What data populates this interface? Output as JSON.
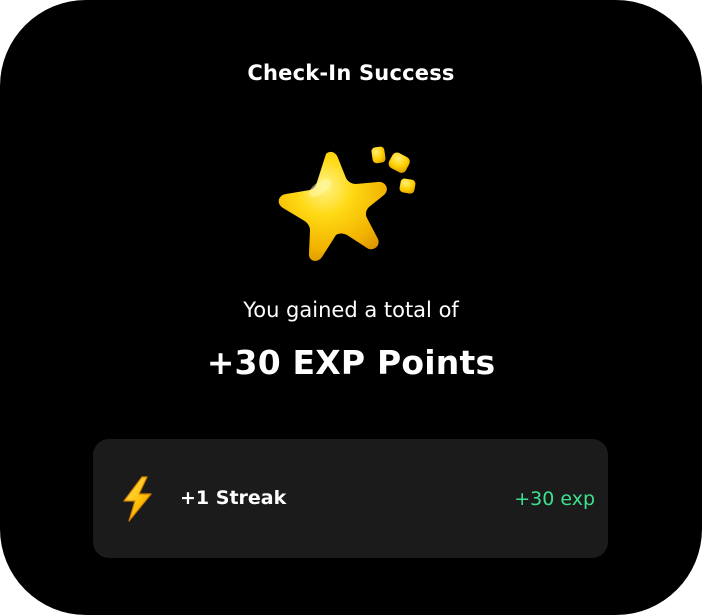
{
  "dialog": {
    "title": "Check-In Success",
    "illustration_icon": "star-icon",
    "subtitle": "You gained a total of",
    "points_text": "+30 EXP Points"
  },
  "streak": {
    "icon": "lightning-bolt-icon",
    "label": "+1 Streak",
    "exp_text": "+30 exp",
    "exp_color": "#3ee08d"
  },
  "colors": {
    "background": "#000000",
    "card": "#1b1b1b",
    "star": "#f5c800",
    "bolt": "#ffc107"
  }
}
